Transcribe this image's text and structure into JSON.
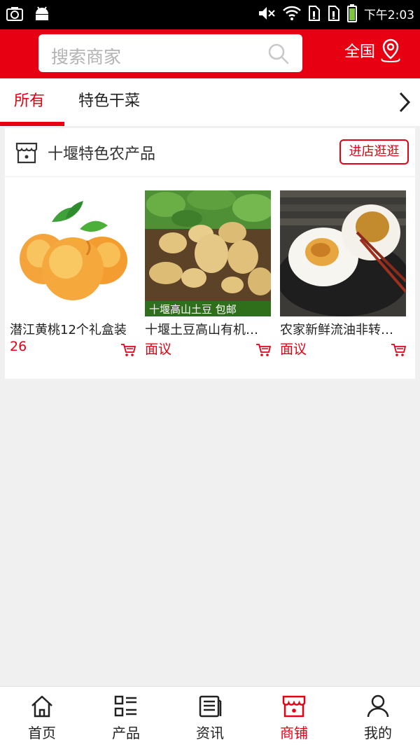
{
  "status_bar": {
    "time": "下午2:03"
  },
  "header": {
    "search_placeholder": "搜索商家",
    "region_label": "全国"
  },
  "tabs": [
    {
      "label": "所有",
      "active": true
    },
    {
      "label": "特色干菜",
      "active": false
    }
  ],
  "shop": {
    "name": "十堰特色农产品",
    "visit_label": "进店逛逛",
    "products": [
      {
        "name": "潜江黄桃12个礼盒装",
        "price": "26",
        "image": "peach"
      },
      {
        "name": "十堰土豆高山有机土豆",
        "price": "面议",
        "image": "potato",
        "image_caption": "十堰高山土豆   包邮"
      },
      {
        "name": "农家新鲜流油非转基因咸鸭蛋",
        "price": "面议",
        "image": "salted-egg"
      }
    ]
  },
  "bottom_nav": [
    {
      "label": "首页",
      "icon": "home-icon",
      "active": false
    },
    {
      "label": "产品",
      "icon": "product-list-icon",
      "active": false
    },
    {
      "label": "资讯",
      "icon": "news-icon",
      "active": false
    },
    {
      "label": "商铺",
      "icon": "shop-icon",
      "active": true
    },
    {
      "label": "我的",
      "icon": "user-icon",
      "active": false
    }
  ],
  "colors": {
    "brand": "#e60012",
    "background": "#f0f0f0"
  }
}
